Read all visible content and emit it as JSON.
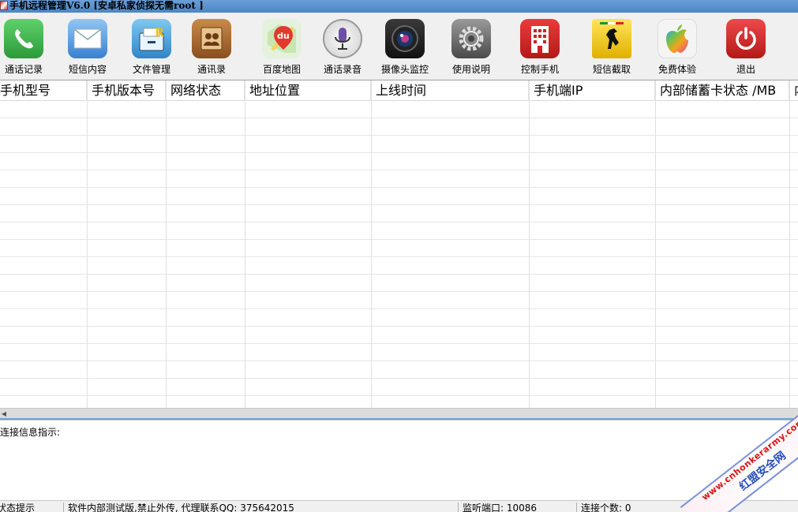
{
  "window": {
    "title": "手机远程管理V6.0 [安卓私家侦探无需root ]"
  },
  "toolbar": {
    "items": [
      {
        "label": "通话记录",
        "icon": "phone-call-icon",
        "color": "#3aa64a"
      },
      {
        "label": "短信内容",
        "icon": "envelope-icon",
        "color": "#3c7fd6"
      },
      {
        "label": "文件管理",
        "icon": "file-cabinet-icon",
        "color": "#3e9ad8"
      },
      {
        "label": "通讯录",
        "icon": "contacts-book-icon",
        "color": "#b5651d"
      },
      {
        "label": "百度地图",
        "icon": "map-pin-icon",
        "color": "#e23a2e"
      },
      {
        "label": "通话录音",
        "icon": "microphone-icon",
        "color": "#6c4fa6"
      },
      {
        "label": "摄像头监控",
        "icon": "camera-lens-icon",
        "color": "#222222"
      },
      {
        "label": "使用说明",
        "icon": "gear-icon",
        "color": "#666666"
      },
      {
        "label": "控制手机",
        "icon": "hotel-building-icon",
        "color": "#d8232a"
      },
      {
        "label": "短信截取",
        "icon": "ferrari-horse-icon",
        "color": "#f2c200"
      },
      {
        "label": "免费体验",
        "icon": "apple-logo-icon",
        "color": "#e2449b"
      },
      {
        "label": "退出",
        "icon": "power-icon",
        "color": "#d32727"
      }
    ]
  },
  "table": {
    "columns": [
      "手机型号",
      "手机版本号",
      "网络状态",
      "地址位置",
      "上线时间",
      "手机端IP",
      "内部储蓄卡状态 /MB",
      "内"
    ],
    "rows": []
  },
  "connection_panel": {
    "label": "连接信息指示:"
  },
  "statusbar": {
    "cells": [
      "状态提示",
      "软件内部测试版,禁止外传, 代理联系QQ: 375642015",
      "监听端口: 10086",
      "连接个数: 0"
    ]
  },
  "watermark": {
    "url": "www.cnhonkerarmy.com",
    "name": "红盟安全网"
  }
}
